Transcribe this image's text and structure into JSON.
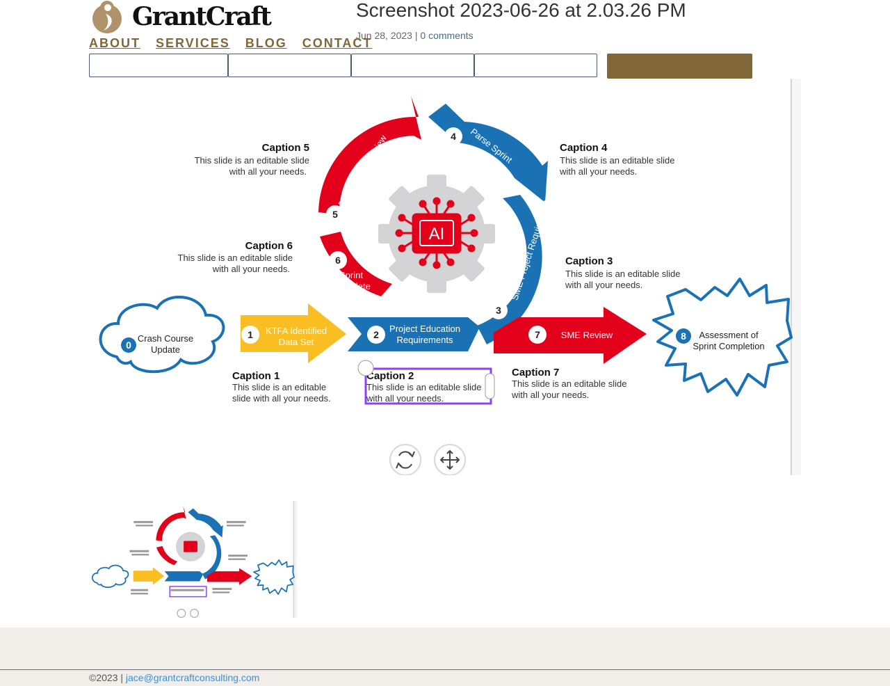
{
  "site": {
    "brand": "GrantCraft",
    "nav": [
      "ABOUT",
      "SERVICES",
      "BLOG",
      "CONTACT"
    ]
  },
  "post": {
    "title": "Screenshot 2023-06-26 at 2.03.26 PM",
    "date": "Jun 28, 2023",
    "separator": "|",
    "comments": "0 comments"
  },
  "form": {
    "fields": [
      "",
      "",
      "",
      ""
    ],
    "submit_label": ""
  },
  "slide": {
    "center_label": "AI",
    "steps": [
      {
        "num": "0",
        "label": "Crash Course Update"
      },
      {
        "num": "1",
        "label": "KTFA Identified Data Set"
      },
      {
        "num": "2",
        "label": "Project Education Requirements"
      },
      {
        "num": "3",
        "label": "SME Project Requirements"
      },
      {
        "num": "4",
        "label": "Parse Sprint"
      },
      {
        "num": "5",
        "label": "Data Format Review"
      },
      {
        "num": "6",
        "label": "Sprint Complete"
      },
      {
        "num": "7",
        "label": "SME Review"
      },
      {
        "num": "8",
        "label": "Assessment of Sprint Completion"
      }
    ],
    "captions": [
      {
        "title": "Caption 1",
        "lines": [
          "This slide is an editable",
          "slide with all your needs."
        ]
      },
      {
        "title": "Caption 2",
        "lines": [
          "This slide is an editable slide",
          "with all your needs."
        ]
      },
      {
        "title": "Caption 3",
        "lines": [
          "This slide is an editable slide",
          "with all your needs."
        ]
      },
      {
        "title": "Caption 4",
        "lines": [
          "This slide is an editable slide",
          "with all your needs."
        ]
      },
      {
        "title": "Caption 5",
        "lines": [
          "This slide is an editable slide",
          "with all your needs."
        ]
      },
      {
        "title": "Caption 6",
        "lines": [
          "This slide is an editable slide",
          "with all your needs."
        ]
      },
      {
        "title": "Caption 7",
        "lines": [
          "This slide is an editable slide",
          "with all your needs."
        ]
      }
    ],
    "tools": [
      "rotate-icon",
      "move-icon"
    ]
  },
  "footer": {
    "copyright": "©2023",
    "separator": "|",
    "email": "jace@grantcraftconsulting.com"
  },
  "colors": {
    "brand_gold": "#836638",
    "red": "#e2001a",
    "blue": "#1a72b5",
    "yellow": "#f9be22",
    "gear_gray": "#d4d4d6",
    "selection_purple": "#8b44f2",
    "footer_bg": "#f1ede8",
    "link_blue": "#3a8fd6"
  }
}
